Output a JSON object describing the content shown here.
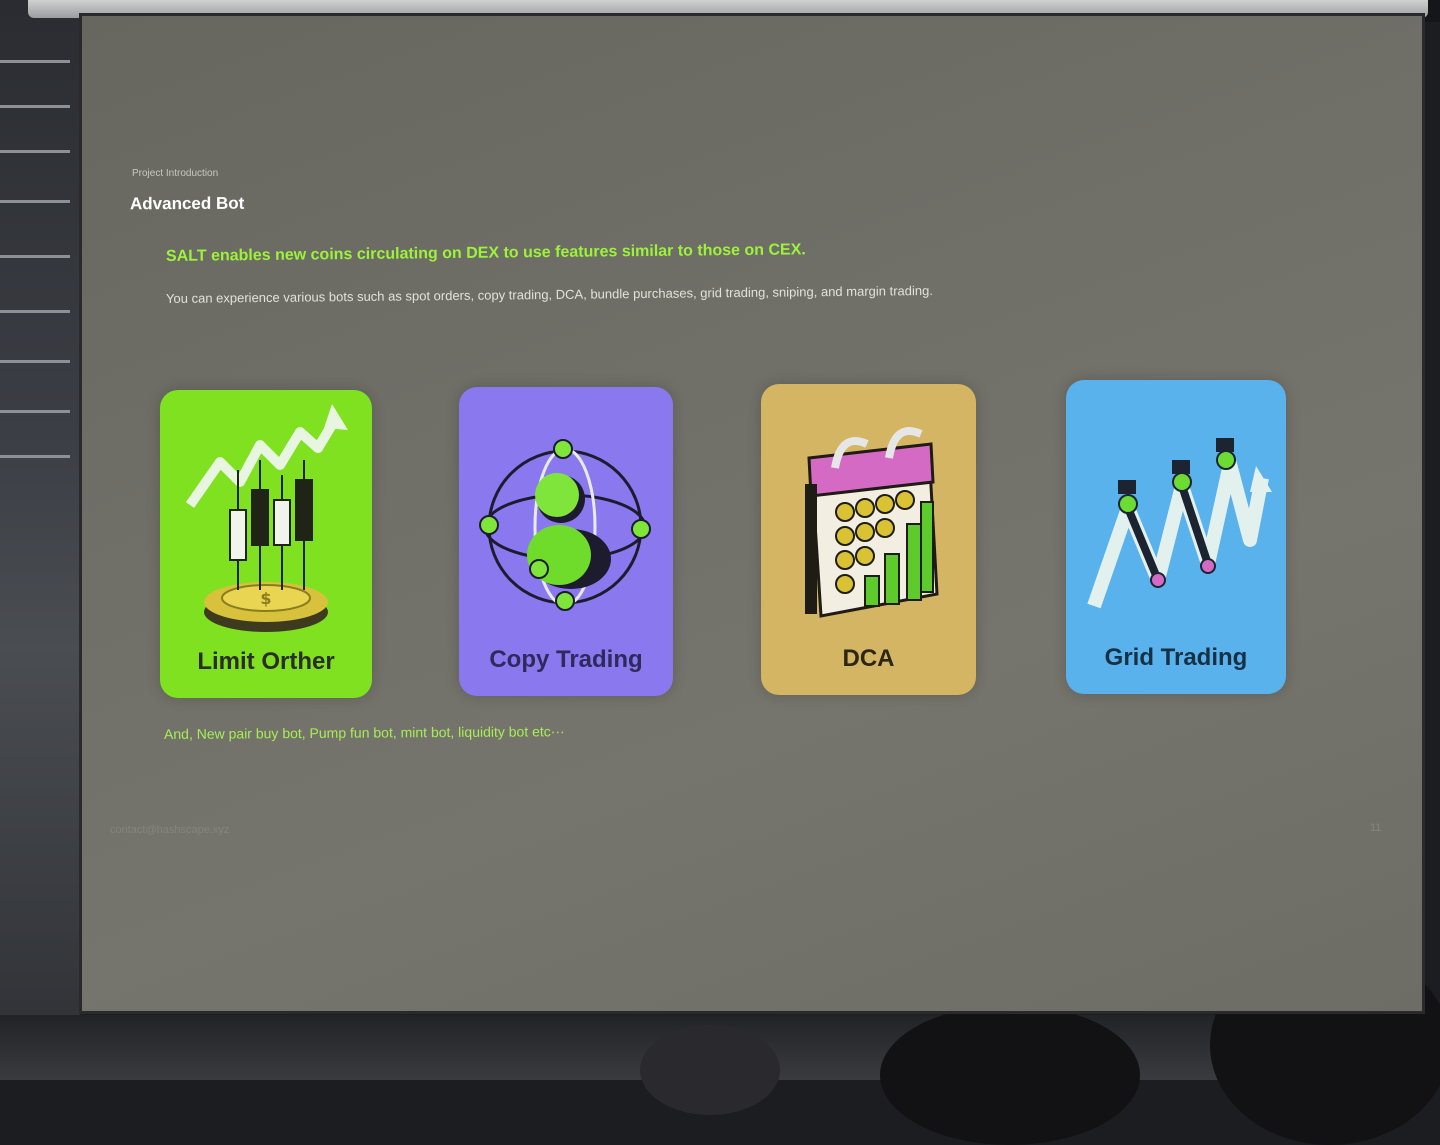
{
  "slide": {
    "section_label": "Project Introduction",
    "title": "Advanced Bot",
    "headline": "SALT enables new coins circulating on DEX to use features similar to those on CEX.",
    "description": "You can experience various bots such as spot orders, copy trading, DCA, bundle purchases, grid trading, sniping, and margin trading.",
    "footer_note": "And, New pair buy bot, Pump fun bot, mint bot, liquidity bot etc···",
    "contact": "contact@hashscape.xyz",
    "page_number": "11"
  },
  "cards": [
    {
      "label": "Limit Orther",
      "icon": "candlestick-coin-icon",
      "color": "#7fe11f"
    },
    {
      "label": "Copy Trading",
      "icon": "person-orbit-icon",
      "color": "#8a78ef"
    },
    {
      "label": "DCA",
      "icon": "calendar-coins-icon",
      "color": "#d3b563"
    },
    {
      "label": "Grid Trading",
      "icon": "grid-zigzag-icon",
      "color": "#5ab2ec"
    }
  ],
  "colors": {
    "accent_green": "#9cf33a",
    "screen": "#6f6f68"
  }
}
